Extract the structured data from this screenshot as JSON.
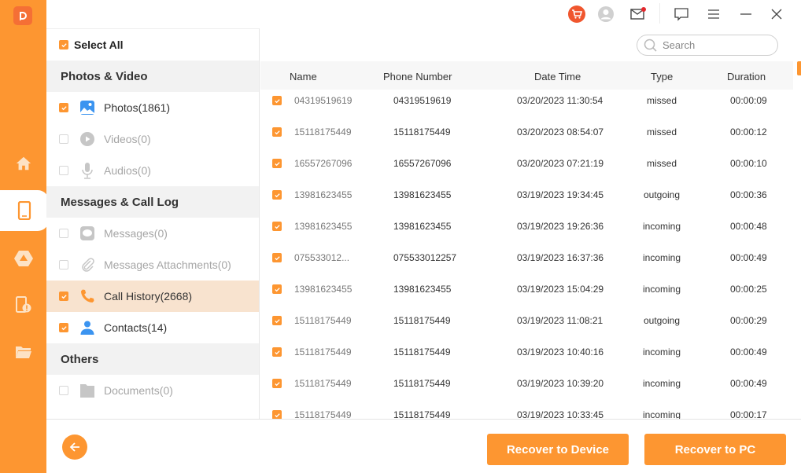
{
  "app": {
    "logo_letter": "D",
    "accent_color": "#fd9631"
  },
  "rail": {
    "items": [
      {
        "name": "home",
        "icon": "home-icon",
        "active": false
      },
      {
        "name": "device",
        "icon": "phone-icon",
        "active": true
      },
      {
        "name": "google-drive",
        "icon": "drive-icon",
        "active": false
      },
      {
        "name": "device-issue",
        "icon": "phone-alert-icon",
        "active": false
      },
      {
        "name": "folder",
        "icon": "folder-icon",
        "active": false
      }
    ]
  },
  "topbar": {
    "icons": [
      "cart-icon",
      "user-icon",
      "mail-icon",
      "feedback-icon",
      "menu-icon",
      "minimize-icon",
      "close-icon"
    ]
  },
  "categories": {
    "select_all_label": "Select All",
    "select_all_checked": true,
    "groups": [
      {
        "title": "Photos & Video",
        "items": [
          {
            "label": "Photos(1861)",
            "checked": true,
            "enabled": true,
            "icon": "photo-icon"
          },
          {
            "label": "Videos(0)",
            "checked": false,
            "enabled": false,
            "icon": "video-icon"
          },
          {
            "label": "Audios(0)",
            "checked": false,
            "enabled": false,
            "icon": "microphone-icon"
          }
        ]
      },
      {
        "title": "Messages & Call Log",
        "items": [
          {
            "label": "Messages(0)",
            "checked": false,
            "enabled": false,
            "icon": "message-icon"
          },
          {
            "label": "Messages Attachments(0)",
            "checked": false,
            "enabled": false,
            "icon": "paperclip-icon"
          },
          {
            "label": "Call History(2668)",
            "checked": true,
            "enabled": true,
            "selected": true,
            "icon": "phone-call-icon"
          },
          {
            "label": "Contacts(14)",
            "checked": true,
            "enabled": true,
            "icon": "contact-icon"
          }
        ]
      },
      {
        "title": "Others",
        "items": [
          {
            "label": "Documents(0)",
            "checked": false,
            "enabled": false,
            "icon": "document-folder-icon"
          }
        ]
      }
    ]
  },
  "search": {
    "placeholder": "Search",
    "value": ""
  },
  "table": {
    "columns": [
      "Name",
      "Phone Number",
      "Date Time",
      "Type",
      "Duration"
    ],
    "rows": [
      {
        "checked": true,
        "name": "04319519619",
        "phone": "04319519619",
        "datetime": "03/20/2023 11:30:54",
        "type": "missed",
        "duration": "00:00:09"
      },
      {
        "checked": true,
        "name": "15118175449",
        "phone": "15118175449",
        "datetime": "03/20/2023 08:54:07",
        "type": "missed",
        "duration": "00:00:12"
      },
      {
        "checked": true,
        "name": "16557267096",
        "phone": "16557267096",
        "datetime": "03/20/2023 07:21:19",
        "type": "missed",
        "duration": "00:00:10"
      },
      {
        "checked": true,
        "name": "13981623455",
        "phone": "13981623455",
        "datetime": "03/19/2023 19:34:45",
        "type": "outgoing",
        "duration": "00:00:36"
      },
      {
        "checked": true,
        "name": "13981623455",
        "phone": "13981623455",
        "datetime": "03/19/2023 19:26:36",
        "type": "incoming",
        "duration": "00:00:48"
      },
      {
        "checked": true,
        "name": "075533012...",
        "phone": "075533012257",
        "datetime": "03/19/2023 16:37:36",
        "type": "incoming",
        "duration": "00:00:49"
      },
      {
        "checked": true,
        "name": "13981623455",
        "phone": "13981623455",
        "datetime": "03/19/2023 15:04:29",
        "type": "incoming",
        "duration": "00:00:25"
      },
      {
        "checked": true,
        "name": "15118175449",
        "phone": "15118175449",
        "datetime": "03/19/2023 11:08:21",
        "type": "outgoing",
        "duration": "00:00:29"
      },
      {
        "checked": true,
        "name": "15118175449",
        "phone": "15118175449",
        "datetime": "03/19/2023 10:40:16",
        "type": "incoming",
        "duration": "00:00:49"
      },
      {
        "checked": true,
        "name": "15118175449",
        "phone": "15118175449",
        "datetime": "03/19/2023 10:39:20",
        "type": "incoming",
        "duration": "00:00:49"
      },
      {
        "checked": true,
        "name": "15118175449",
        "phone": "15118175449",
        "datetime": "03/19/2023 10:33:45",
        "type": "incoming",
        "duration": "00:00:17"
      }
    ]
  },
  "footer": {
    "back_icon": "arrow-left-icon",
    "recover_device_label": "Recover to Device",
    "recover_pc_label": "Recover to PC"
  }
}
